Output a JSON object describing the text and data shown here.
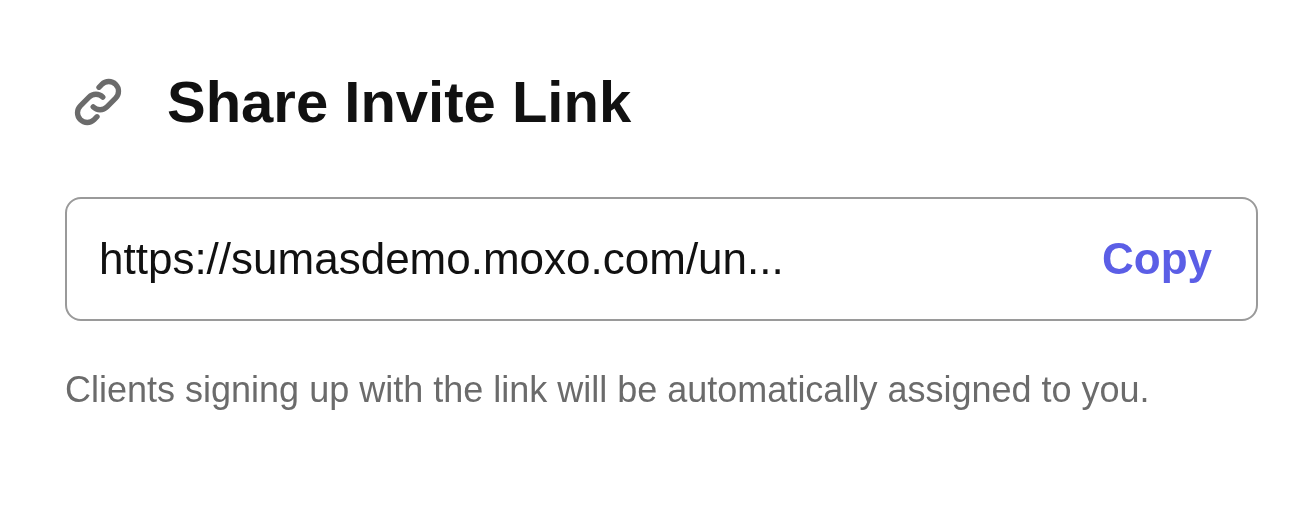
{
  "header": {
    "title": "Share Invite Link"
  },
  "link_field": {
    "value": "https://sumasdemo.moxo.com/un...",
    "action": "Copy"
  },
  "helper_text": "Clients signing up with the link will be automatically assigned to you."
}
